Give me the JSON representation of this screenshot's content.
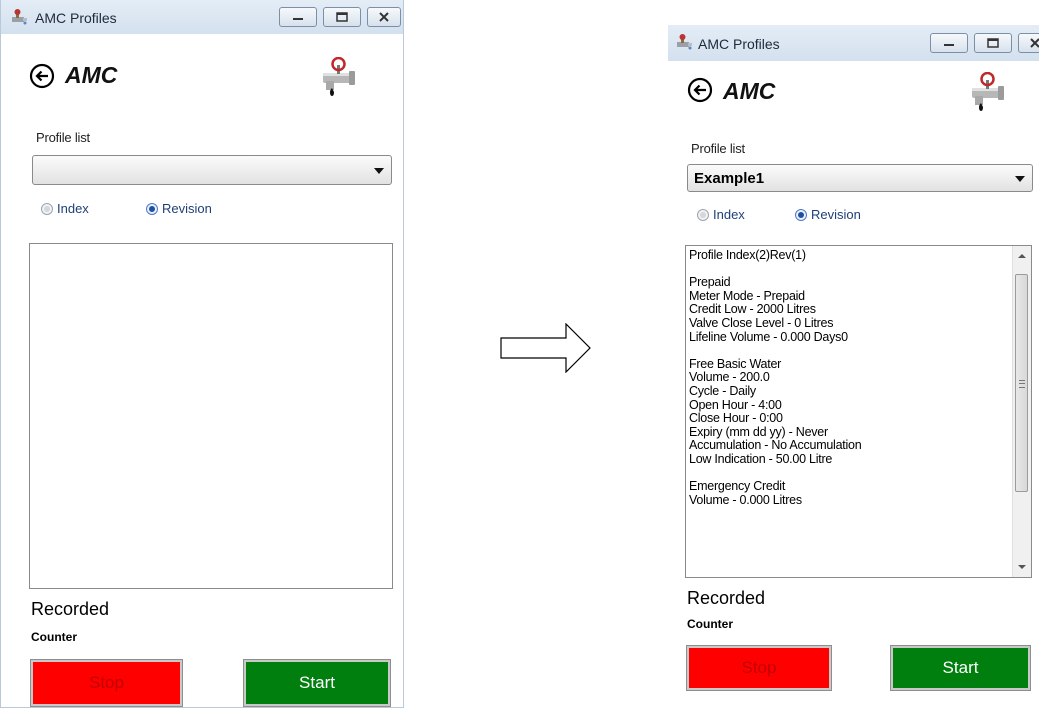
{
  "colors": {
    "stop_bg": "#ff0000",
    "stop_text": "#c10000",
    "start_bg": "#007f0e",
    "start_text": "#ffffff",
    "titlebar": "#dbe6f2"
  },
  "transition_icon": "right-arrow-icon",
  "left_window": {
    "title": "AMC Profiles",
    "app_name": "AMC",
    "profile_list_label": "Profile list",
    "profile_selected": "",
    "radio_index": "Index",
    "radio_revision": "Revision",
    "selected_radio": "Revision",
    "recorded": "Recorded",
    "counter": "Counter",
    "stop_label": "Stop",
    "start_label": "Start"
  },
  "right_window": {
    "title": "AMC Profiles",
    "app_name": "AMC",
    "profile_list_label": "Profile list",
    "profile_selected": "Example1",
    "radio_index": "Index",
    "radio_revision": "Revision",
    "selected_radio": "Revision",
    "profile_lines": [
      "Profile Index(2)Rev(1)",
      "",
      "Prepaid",
      "Meter Mode - Prepaid",
      "Credit Low - 2000 Litres",
      "Valve Close Level - 0 Litres",
      "Lifeline Volume - 0.000 Days0",
      "",
      "Free Basic Water",
      "Volume - 200.0",
      "Cycle - Daily",
      "Open Hour - 4:00",
      "Close Hour - 0:00",
      "Expiry (mm dd yy) - Never",
      "Accumulation - No Accumulation",
      "Low Indication - 50.00 Litre",
      "",
      "Emergency Credit",
      "Volume - 0.000 Litres"
    ],
    "recorded": "Recorded",
    "counter": "Counter",
    "stop_label": "Stop",
    "start_label": "Start"
  }
}
